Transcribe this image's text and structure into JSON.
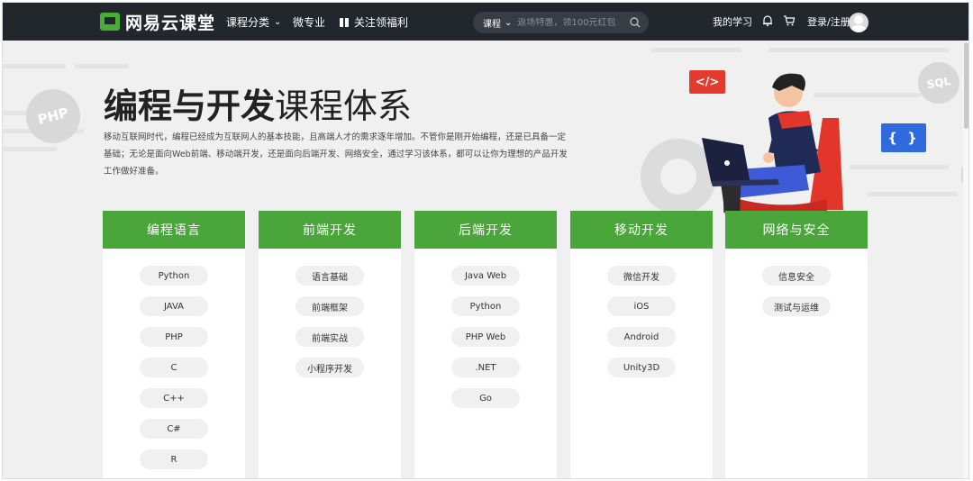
{
  "header": {
    "logo_text": "网易云课堂",
    "nav_category": "课程分类",
    "nav_major": "微专业",
    "nav_gift": "关注领福利",
    "search_type": "课程",
    "search_placeholder": "返场特惠，领100元红包",
    "my_study": "我的学习",
    "login": "登录/注册"
  },
  "hero": {
    "title_bold": "编程与开发",
    "title_light": "课程体系",
    "description": "移动互联网时代，编程已经成为互联网人的基本技能，且高端人才的需求逐年增加。不管你是刚开始编程，还是已具备一定基础；无论是面向Web前端、移动端开发，还是面向后端开发、网络安全，通过学习该体系，都可以让你为理想的产品开发工作做好准备。",
    "badge_php": "PHP",
    "badge_sql": "SQL",
    "badge_code": "</>",
    "badge_brace": "{ }"
  },
  "colors": {
    "accent": "#4aa53a",
    "topbar": "#22262d",
    "red": "#e33b2e",
    "blue": "#2f6bdc"
  },
  "categories": [
    {
      "title": "编程语言",
      "items": [
        "Python",
        "JAVA",
        "PHP",
        "C",
        "C++",
        "C#",
        "R"
      ]
    },
    {
      "title": "前端开发",
      "items": [
        "语言基础",
        "前端框架",
        "前端实战",
        "小程序开发"
      ]
    },
    {
      "title": "后端开发",
      "items": [
        "Java Web",
        "Python",
        "PHP Web",
        ".NET",
        "Go"
      ]
    },
    {
      "title": "移动开发",
      "items": [
        "微信开发",
        "iOS",
        "Android",
        "Unity3D"
      ]
    },
    {
      "title": "网络与安全",
      "items": [
        "信息安全",
        "测试与运维"
      ]
    }
  ]
}
